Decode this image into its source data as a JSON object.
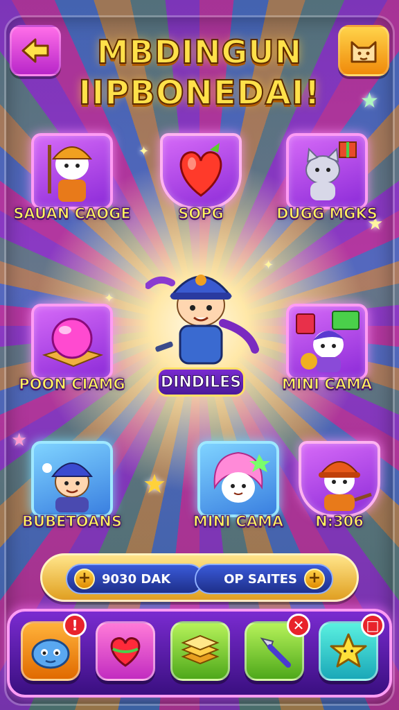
{
  "header": {
    "title_line1": "MBDINGUN",
    "title_line2": "IIPBONEDAI!",
    "back_icon": "arrow-left-icon",
    "profile_icon": "cat-face-icon"
  },
  "tiles": [
    {
      "label": "SAUAN CAOGE",
      "icon": "firefighter-character-icon"
    },
    {
      "label": "SOPG",
      "icon": "heart-fruit-icon"
    },
    {
      "label": "DUGG MGKS",
      "icon": "cat-with-gift-icon"
    },
    {
      "label": "POON CIAMG",
      "icon": "pink-orb-icon"
    },
    {
      "label": "DINDILES",
      "icon": "hero-firefighter-icon"
    },
    {
      "label": "MINI CAMA",
      "icon": "boy-with-cash-icon"
    },
    {
      "label": "BUBETOANS",
      "icon": "helmet-boy-icon"
    },
    {
      "label": "MINI CAMA",
      "icon": "pink-hair-creature-icon"
    },
    {
      "label": "N:306",
      "icon": "fox-firefighter-icon"
    }
  ],
  "currency": {
    "left_label": "9030 DAK",
    "right_label": "OP SAITES",
    "plus_symbol": "+"
  },
  "bottom_nav": [
    {
      "icon": "blue-monster-icon",
      "badge": "!"
    },
    {
      "icon": "heart-icon",
      "badge": ""
    },
    {
      "icon": "stack-cards-icon",
      "badge": ""
    },
    {
      "icon": "wand-icon",
      "badge": "✕"
    },
    {
      "icon": "star-icon",
      "badge": "□"
    }
  ],
  "colors": {
    "title": "#ffe14a",
    "label": "#fff45c",
    "accent_pink": "#ff9cf4",
    "accent_gold": "#ffd34a"
  }
}
